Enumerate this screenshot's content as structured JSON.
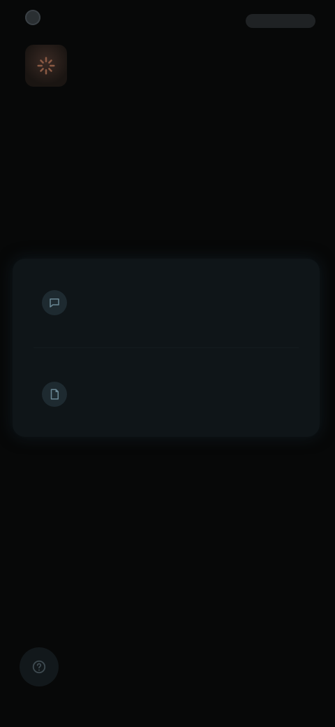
{
  "app": {
    "name": "",
    "top_action_label": ""
  },
  "hero": {
    "icon": "spark-icon"
  },
  "title": {
    "accent": "",
    "rest": ""
  },
  "options": [
    {
      "icon": "chat-icon",
      "title": "",
      "subtitle": ""
    },
    {
      "icon": "document-icon",
      "title": "",
      "subtitle": ""
    }
  ],
  "footnote": "",
  "fab": {
    "icon": "help-icon"
  },
  "colors": {
    "background": "#070808",
    "accent": "#c9724a",
    "card": "#0f1518"
  }
}
